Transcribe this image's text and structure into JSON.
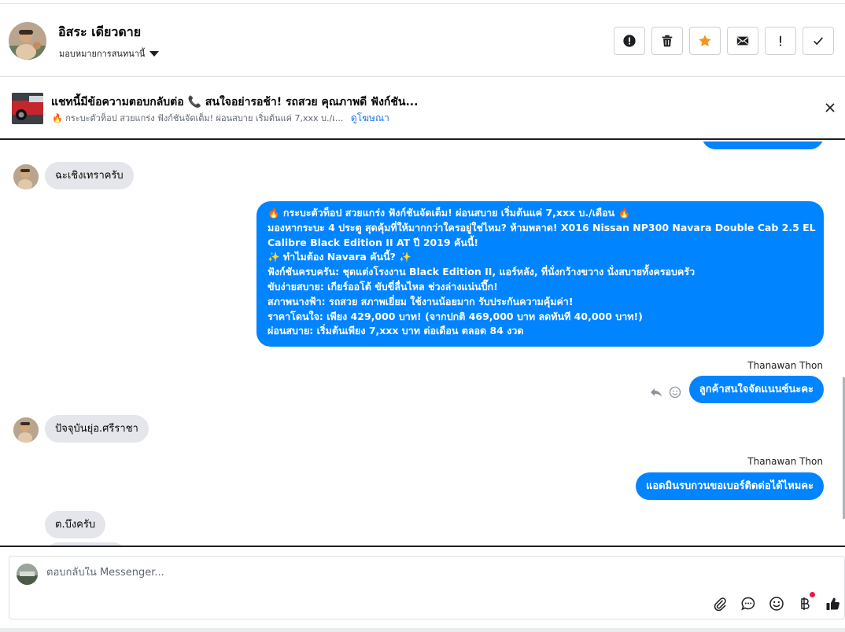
{
  "header": {
    "contact_name": "อิสระ เดียวดาย",
    "assign_label": "มอบหมายการสนทนานี้",
    "actions": [
      {
        "name": "spam-button",
        "icon": "alert-circle-icon"
      },
      {
        "name": "delete-button",
        "icon": "trash-icon"
      },
      {
        "name": "star-button",
        "icon": "star-icon"
      },
      {
        "name": "mark-unread-button",
        "icon": "envelope-icon"
      },
      {
        "name": "follow-up-button",
        "icon": "exclamation-icon"
      },
      {
        "name": "done-button",
        "icon": "check-icon"
      }
    ]
  },
  "ad": {
    "title": "แชทนี้มีข้อความตอบกลับต่อ 📞 สนใจอย่ารอช้า! รถสวย คุณภาพดี ฟังก์ชัน...",
    "subtitle": "🔥 กระบะตัวท็อป สวยแกร่ง ฟังก์ชันจัดเต็ม! ผ่อนสบาย เริ่มต้นแค่ 7,xxx บ./เ...",
    "link": "ดูโฆษณา"
  },
  "messages": {
    "in_1": "ฉะเชิงเทราครับ",
    "ad_lines": [
      "🔥 กระบะตัวท็อป สวยแกร่ง ฟังก์ชันจัดเต็ม! ผ่อนสบาย เริ่มต้นแค่ 7,xxx บ./เดือน 🔥",
      "มองหากระบะ 4 ประตู สุดคุ้มที่ให้มากกว่าใครอยู่ใช่ไหม? ห้ามพลาด! X016 Nissan NP300 Navara Double Cab 2.5 EL",
      "Calibre Black Edition II AT ปี 2019 คันนี้!",
      "✨ ทำไมต้อง Navara คันนี้? ✨",
      "ฟังก์ชันครบครัน: ชุดแต่งโรงงาน Black Edition II, แอร์หลัง, ที่นั่งกว้างขวาง นั่งสบายทั้งครอบครัว",
      "ขับง่ายสบาย: เกียร์ออโต้ ขับขี่ลื่นไหล ช่วงล่างแน่นปึ๊ก!",
      "สภาพนางฟ้า: รถสวย สภาพเยี่ยม ใช้งานน้อยมาก รับประกันความคุ้มค่า!",
      "ราคาโดนใจ: เพียง 429,000 บาท! (จากปกติ 469,000 บาท ลดทันที 40,000 บาท!)",
      "ผ่อนสบาย: เริ่มต้นเพียง 7,xxx บาท ต่อเดือน ตลอด 84 งวด"
    ],
    "sender_1": "Thanawan Thon",
    "out_1": "ลูกค้าสนใจจัดแนนซ์นะคะ",
    "in_2": "ปัจจุบันยุ่อ.ศรีราชา",
    "sender_2": "Thanawan Thon",
    "out_2": "แอดมินรบกวนขอเบอร์ติดต่อได้ไหมคะ",
    "in_3": "ต.บึงครับ"
  },
  "composer": {
    "placeholder": "ตอบกลับใน Messenger...",
    "tools": [
      "paperclip-icon",
      "chat-bubble-icon",
      "emoji-icon",
      "baht-icon",
      "thumbs-up-icon"
    ]
  },
  "colors": {
    "outgoing_bubble": "#0084ff",
    "incoming_bubble": "#e4e6eb",
    "star": "#f7941d"
  }
}
